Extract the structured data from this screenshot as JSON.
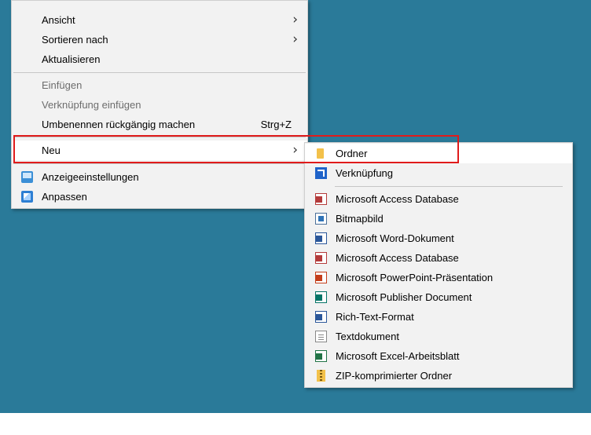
{
  "context_menu": {
    "items": [
      {
        "label": "Ansicht",
        "submenu": true
      },
      {
        "label": "Sortieren nach",
        "submenu": true
      },
      {
        "label": "Aktualisieren"
      },
      {
        "label": "Einfügen",
        "disabled": true
      },
      {
        "label": "Verknüpfung einfügen",
        "disabled": true
      },
      {
        "label": "Umbenennen rückgängig machen",
        "shortcut": "Strg+Z"
      },
      {
        "label": "Neu",
        "submenu": true,
        "highlighted": true
      },
      {
        "label": "Anzeigeeinstellungen",
        "icon": "display-settings-icon"
      },
      {
        "label": "Anpassen",
        "icon": "personalize-icon"
      }
    ],
    "chevron": "›"
  },
  "submenu": {
    "items": [
      {
        "label": "Ordner",
        "icon": "folder-icon",
        "highlighted": true
      },
      {
        "label": "Verknüpfung",
        "icon": "shortcut-icon"
      },
      {
        "label": "Microsoft Access Database",
        "icon": "access-icon"
      },
      {
        "label": "Bitmapbild",
        "icon": "bitmap-icon"
      },
      {
        "label": "Microsoft Word-Dokument",
        "icon": "word-icon"
      },
      {
        "label": "Microsoft Access Database",
        "icon": "access-icon"
      },
      {
        "label": "Microsoft PowerPoint-Präsentation",
        "icon": "powerpoint-icon"
      },
      {
        "label": "Microsoft Publisher Document",
        "icon": "publisher-icon"
      },
      {
        "label": "Rich-Text-Format",
        "icon": "rtf-icon"
      },
      {
        "label": "Textdokument",
        "icon": "text-document-icon"
      },
      {
        "label": "Microsoft Excel-Arbeitsblatt",
        "icon": "excel-icon"
      },
      {
        "label": "ZIP-komprimierter Ordner",
        "icon": "zip-folder-icon"
      }
    ]
  },
  "colors": {
    "desktop": "#2a7a99",
    "menu_bg": "#f2f2f2",
    "highlight_box": "#e01b1b"
  }
}
